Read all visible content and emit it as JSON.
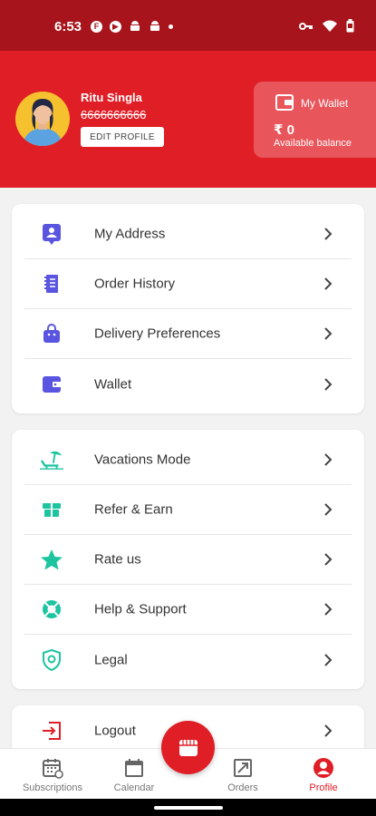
{
  "status_bar": {
    "time": "6:53",
    "icons": [
      "f-icon",
      "play-icon",
      "android-icon",
      "android-icon",
      "dot-icon"
    ],
    "right_icons": [
      "vpn-key-icon",
      "wifi-icon",
      "battery-icon"
    ]
  },
  "profile": {
    "name": "Ritu Singla",
    "phone": "6666666666",
    "edit_label": "EDIT PROFILE"
  },
  "wallet_card": {
    "title": "My Wallet",
    "amount": "₹ 0",
    "subtitle": "Available balance"
  },
  "menu_group_1": [
    {
      "label": "My Address",
      "icon": "address-icon"
    },
    {
      "label": "Order History",
      "icon": "receipt-icon"
    },
    {
      "label": "Delivery Preferences",
      "icon": "bag-icon"
    },
    {
      "label": "Wallet",
      "icon": "wallet-icon"
    }
  ],
  "menu_group_2": [
    {
      "label": "Vacations Mode",
      "icon": "beach-icon"
    },
    {
      "label": "Refer & Earn",
      "icon": "gift-icon"
    },
    {
      "label": "Rate us",
      "icon": "star-icon"
    },
    {
      "label": "Help & Support",
      "icon": "lifebuoy-icon"
    },
    {
      "label": "Legal",
      "icon": "shield-icon"
    }
  ],
  "menu_group_3": [
    {
      "label": "Logout",
      "icon": "logout-icon"
    }
  ],
  "bottom_nav": [
    {
      "label": "Subscriptions",
      "icon": "subscriptions-icon"
    },
    {
      "label": "Calendar",
      "icon": "calendar-icon"
    },
    {
      "label": "Orders",
      "icon": "orders-icon"
    },
    {
      "label": "Profile",
      "icon": "profile-icon",
      "active": true
    }
  ],
  "colors": {
    "status_bar": "#a8141b",
    "brand_red": "#e01e26",
    "blue_icon": "#5a55e0",
    "green_icon": "#1cc4a0"
  }
}
